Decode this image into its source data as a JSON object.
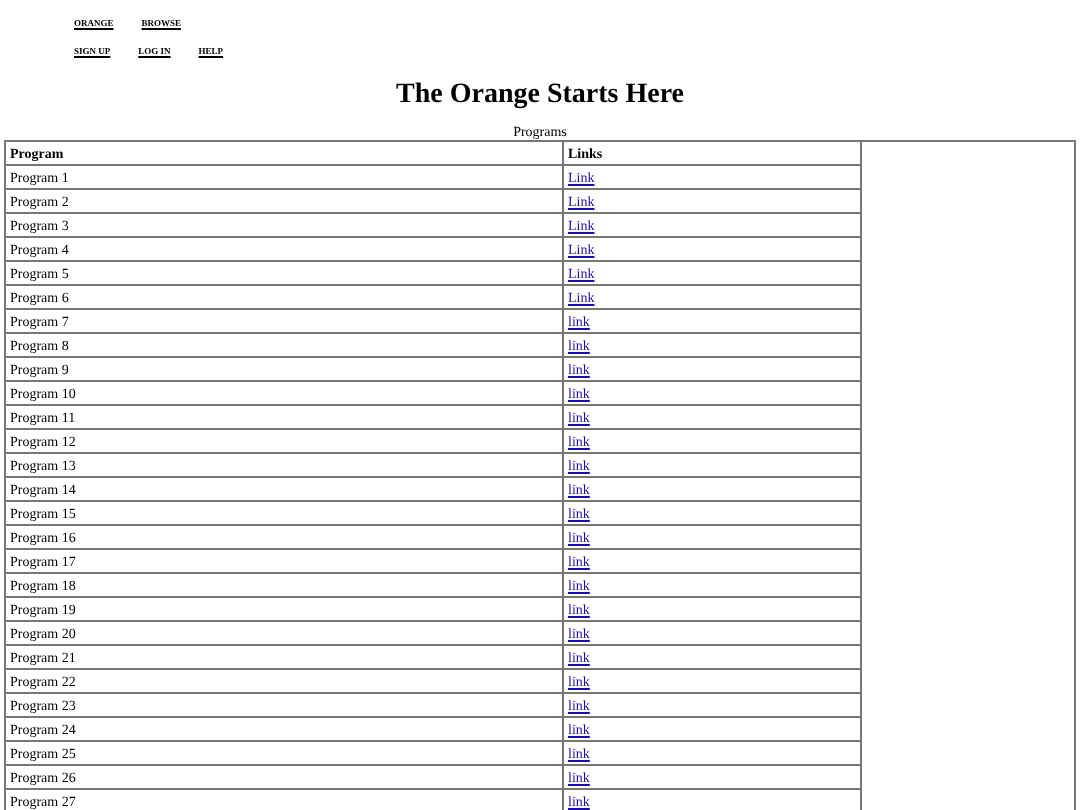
{
  "nav_rows": [
    [
      "ORANGE",
      "BROWSE"
    ],
    [
      "SIGN UP",
      "LOG IN",
      "HELP"
    ]
  ],
  "title": "The Orange Starts Here",
  "table": {
    "caption": "Programs",
    "columns": [
      "Program",
      "Links"
    ],
    "rows": [
      {
        "program": "Program 1",
        "link": "Link"
      },
      {
        "program": "Program 2",
        "link": "Link"
      },
      {
        "program": "Program 3",
        "link": "Link"
      },
      {
        "program": "Program 4",
        "link": "Link"
      },
      {
        "program": "Program 5",
        "link": "Link"
      },
      {
        "program": "Program 6",
        "link": "Link"
      },
      {
        "program": "Program 7",
        "link": "link"
      },
      {
        "program": "Program 8",
        "link": "link"
      },
      {
        "program": "Program 9",
        "link": "link"
      },
      {
        "program": "Program 10",
        "link": "link"
      },
      {
        "program": "Program 11",
        "link": "link"
      },
      {
        "program": "Program 12",
        "link": "link"
      },
      {
        "program": "Program 13",
        "link": "link"
      },
      {
        "program": "Program 14",
        "link": "link"
      },
      {
        "program": "Program 15",
        "link": "link"
      },
      {
        "program": "Program 16",
        "link": "link"
      },
      {
        "program": "Program 17",
        "link": "link"
      },
      {
        "program": "Program 18",
        "link": "link"
      },
      {
        "program": "Program 19",
        "link": "link"
      },
      {
        "program": "Program 20",
        "link": "link"
      },
      {
        "program": "Program 21",
        "link": "link"
      },
      {
        "program": "Program 22",
        "link": "link"
      },
      {
        "program": "Program 23",
        "link": "link"
      },
      {
        "program": "Program 24",
        "link": "link"
      },
      {
        "program": "Program 25",
        "link": "link"
      },
      {
        "program": "Program 26",
        "link": "link"
      },
      {
        "program": "Program 27",
        "link": "link"
      }
    ]
  }
}
